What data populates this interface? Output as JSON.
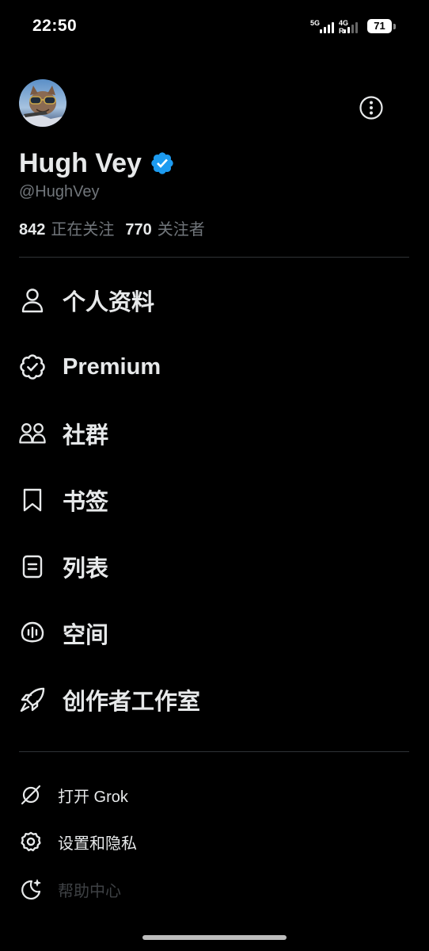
{
  "status_bar": {
    "time": "22:50",
    "sim1_label": "5G",
    "sim2_label": "4G R",
    "battery": "71"
  },
  "profile": {
    "display_name": "Hugh Vey",
    "handle": "@HughVey",
    "following_count": "842",
    "following_label": "正在关注",
    "followers_count": "770",
    "followers_label": "关注者"
  },
  "menu": {
    "items": [
      {
        "label": "个人资料",
        "icon": "person-icon"
      },
      {
        "label": "Premium",
        "icon": "verified-badge-outline-icon"
      },
      {
        "label": "社群",
        "icon": "people-icon"
      },
      {
        "label": "书签",
        "icon": "bookmark-icon"
      },
      {
        "label": "列表",
        "icon": "list-icon"
      },
      {
        "label": "空间",
        "icon": "spaces-mic-icon"
      },
      {
        "label": "创作者工作室",
        "icon": "rocket-icon"
      }
    ]
  },
  "secondary_menu": {
    "items": [
      {
        "label": "打开 Grok",
        "icon": "grok-icon"
      },
      {
        "label": "设置和隐私",
        "icon": "gear-icon"
      },
      {
        "label": "帮助中心",
        "icon": "moon-sparkle-icon"
      }
    ]
  },
  "colors": {
    "background": "#000000",
    "text_primary": "#e7e9ea",
    "text_secondary": "#71767b",
    "verified_blue": "#1d9bf0",
    "divider": "#2f3336"
  }
}
